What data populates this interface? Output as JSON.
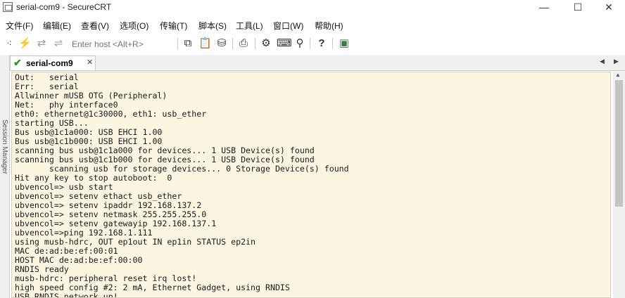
{
  "window": {
    "title": "serial-com9 - SecureCRT",
    "minimize": "—",
    "maximize": "☐",
    "close": "✕"
  },
  "menu": [
    "文件(F)",
    "编辑(E)",
    "查看(V)",
    "选项(O)",
    "传输(T)",
    "脚本(S)",
    "工具(L)",
    "窗口(W)",
    "帮助(H)"
  ],
  "toolbar": {
    "host_placeholder": "Enter host <Alt+R>"
  },
  "session_manager_label": "Session Manager",
  "tabs": [
    {
      "label": "serial-com9",
      "active": true
    }
  ],
  "terminal": {
    "lines": [
      "Out:   serial",
      "Err:   serial",
      "Allwinner mUSB OTG (Peripheral)",
      "Net:   phy interface0",
      "eth0: ethernet@1c30000, eth1: usb_ether",
      "starting USB...",
      "Bus usb@1c1a000: USB EHCI 1.00",
      "Bus usb@1c1b000: USB EHCI 1.00",
      "scanning bus usb@1c1a000 for devices... 1 USB Device(s) found",
      "scanning bus usb@1c1b000 for devices... 1 USB Device(s) found",
      "       scanning usb for storage devices... 0 Storage Device(s) found",
      "Hit any key to stop autoboot:  0",
      "ubvencol=> usb start",
      "ubvencol=> setenv ethact usb_ether",
      "ubvencol=> setenv ipaddr 192.168.137.2",
      "ubvencol=> setenv netmask 255.255.255.0",
      "ubvencol=> setenv gatewayip 192.168.137.1",
      "ubvencol=>ping 192.168.1.111",
      "using musb-hdrc, OUT ep1out IN ep1in STATUS ep2in",
      "MAC de:ad:be:ef:00:01",
      "HOST MAC de:ad:be:ef:00:00",
      "RNDIS ready",
      "musb-hdrc: peripheral reset irq lost!",
      "high speed config #2: 2 mA, Ethernet Gadget, using RNDIS",
      "USB RNDIS network up!"
    ]
  },
  "colors": {
    "terminal_bg": "#fcf5e2",
    "tab_check": "#1c9a2a"
  }
}
